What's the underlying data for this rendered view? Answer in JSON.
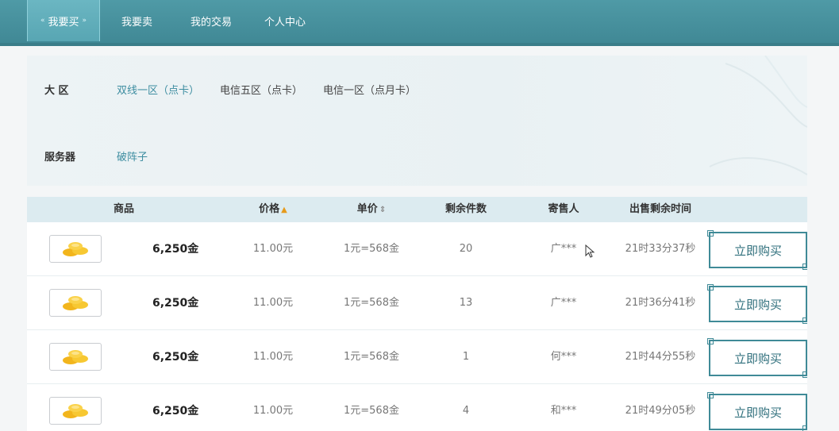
{
  "nav": {
    "items": [
      {
        "label": "我要买",
        "active": true
      },
      {
        "label": "我要卖"
      },
      {
        "label": "我的交易"
      },
      {
        "label": "个人中心"
      }
    ]
  },
  "filter": {
    "region_label": "大 区",
    "regions": [
      "双线一区（点卡）",
      "电信五区（点卡）",
      "电信一区（点月卡）"
    ],
    "server_label": "服务器",
    "servers": [
      "破阵子"
    ]
  },
  "table": {
    "headers": {
      "goods": "商品",
      "price": "价格",
      "unit_price": "单价",
      "remaining": "剩余件数",
      "seller": "寄售人",
      "time_left": "出售剩余时间"
    },
    "rows": [
      {
        "amount": "6,250金",
        "price": "11.00元",
        "unit": "1元=568金",
        "remaining": "20",
        "seller": "广***",
        "time": "21时33分37秒",
        "button": "立即购买"
      },
      {
        "amount": "6,250金",
        "price": "11.00元",
        "unit": "1元=568金",
        "remaining": "13",
        "seller": "广***",
        "time": "21时36分41秒",
        "button": "立即购买"
      },
      {
        "amount": "6,250金",
        "price": "11.00元",
        "unit": "1元=568金",
        "remaining": "1",
        "seller": "何***",
        "time": "21时44分55秒",
        "button": "立即购买"
      },
      {
        "amount": "6,250金",
        "price": "11.00元",
        "unit": "1元=568金",
        "remaining": "4",
        "seller": "和***",
        "time": "21时49分05秒",
        "button": "立即购买"
      }
    ]
  },
  "colors": {
    "nav_bg": "#4f9aa6",
    "accent": "#3d8da0",
    "sort_active": "#e69a1c"
  }
}
